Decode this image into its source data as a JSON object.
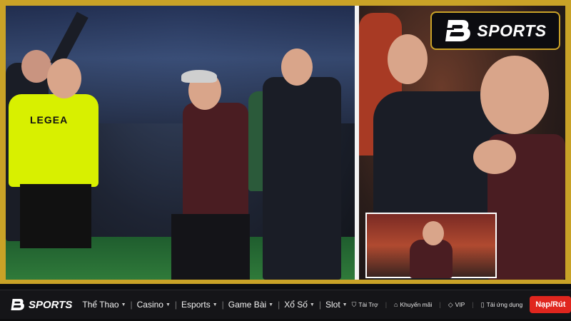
{
  "image": {
    "kit_logo_text": "LEGEA",
    "inset_caption": ""
  },
  "brand": {
    "name": "SPORTS",
    "mark": "B",
    "accent": "#c9a227"
  },
  "navbar": {
    "logo_text": "SPORTS",
    "items": [
      {
        "label": "Thể Thao",
        "icon": "chevron-down-icon"
      },
      {
        "label": "Casino",
        "icon": "chevron-down-icon"
      },
      {
        "label": "Esports",
        "icon": "chevron-down-icon"
      },
      {
        "label": "Game Bài",
        "icon": "chevron-down-icon"
      },
      {
        "label": "Xổ Số",
        "icon": "chevron-down-icon"
      },
      {
        "label": "Slot",
        "icon": "chevron-down-icon"
      }
    ],
    "links": [
      {
        "label": "Tài Trợ",
        "icon": "shield-icon"
      },
      {
        "label": "Khuyến mãi",
        "icon": "tag-icon"
      },
      {
        "label": "VIP",
        "icon": "diamond-icon"
      },
      {
        "label": "Tải ứng dụng",
        "icon": "phone-icon"
      }
    ],
    "cta_label": "Nạp/Rút",
    "cta_color": "#e0261e"
  }
}
